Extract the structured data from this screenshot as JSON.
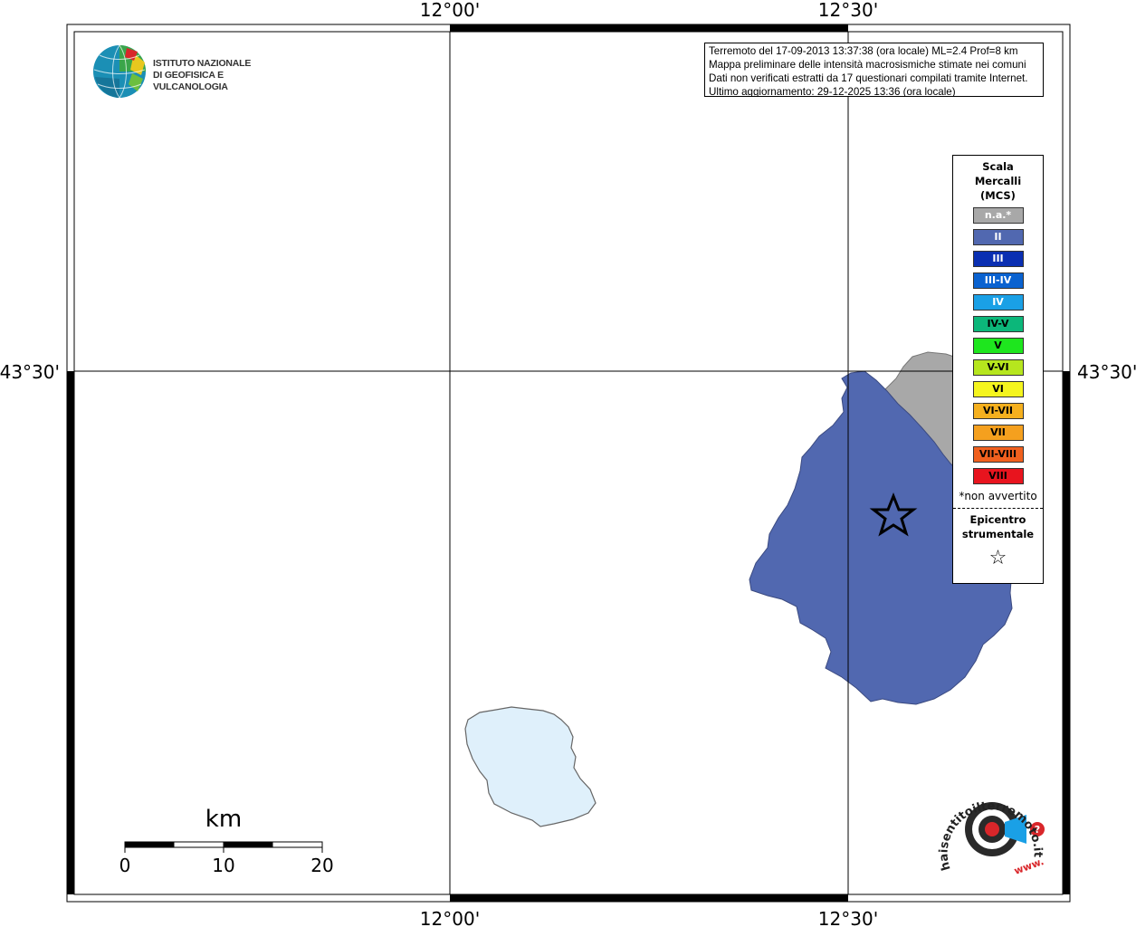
{
  "map": {
    "lon_labels": [
      "12°00'",
      "12°30'"
    ],
    "lat_labels": [
      "43°30'"
    ]
  },
  "info": {
    "line1": "Terremoto del 17-09-2013 13:37:38 (ora locale) ML=2.4 Prof=8 km",
    "line2": "Mappa preliminare delle intensità macrosismiche stimate nei comuni",
    "line3": "Dati non verificati estratti da 17 questionari compilati tramite Internet.",
    "line4": "Ultimo aggiornamento: 29-12-2025 13:36 (ora locale)"
  },
  "logo": {
    "line1": "ISTITUTO NAZIONALE",
    "line2": "DI GEOFISICA E VULCANOLOGIA"
  },
  "legend": {
    "title_lines": [
      "Scala",
      "Mercalli",
      "(MCS)"
    ],
    "items": [
      {
        "label": "n.a.*",
        "color": "#a8a8a8"
      },
      {
        "label": "II",
        "color": "#5168b0"
      },
      {
        "label": "III",
        "color": "#0a2fb2"
      },
      {
        "label": "III-IV",
        "color": "#0a62d0"
      },
      {
        "label": "IV",
        "color": "#1aa0e6"
      },
      {
        "label": "IV-V",
        "color": "#0cb77a"
      },
      {
        "label": "V",
        "color": "#1ee61e"
      },
      {
        "label": "V-VI",
        "color": "#b6e61e"
      },
      {
        "label": "VI",
        "color": "#f5f51e"
      },
      {
        "label": "VI-VII",
        "color": "#f5b01e"
      },
      {
        "label": "VII",
        "color": "#f5a01e"
      },
      {
        "label": "VII-VIII",
        "color": "#f0601e"
      },
      {
        "label": "VIII",
        "color": "#e8141e"
      }
    ],
    "note": "*non avvertito",
    "epicentre_lines": [
      "Epicentro",
      "strumentale"
    ]
  },
  "scalebar": {
    "unit": "km",
    "ticks": [
      "0",
      "10",
      "20"
    ]
  },
  "intensity_areas": [
    {
      "label": "II",
      "color": "#5168b0"
    },
    {
      "label": "n.a.*",
      "color": "#a8a8a8"
    }
  ],
  "lake": {
    "color": "#dff0fb"
  },
  "badge": {
    "site": "haisentitoilterremoto.it",
    "prefix": "www."
  }
}
